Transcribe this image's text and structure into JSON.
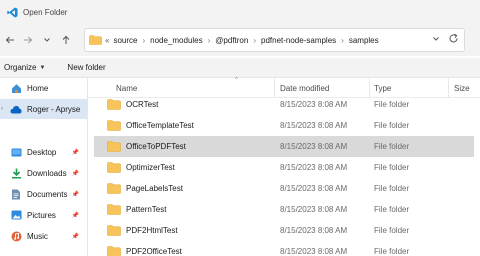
{
  "window": {
    "title": "Open Folder"
  },
  "nav": {
    "back_icon": "arrow-left-icon",
    "forward_icon": "arrow-right-icon",
    "recent_icon": "chevron-down-icon",
    "up_icon": "arrow-up-icon",
    "breadcrumbs": [
      "source",
      "node_modules",
      "@pdftron",
      "pdfnet-node-samples",
      "samples"
    ],
    "overflow": "«",
    "refresh_icon": "refresh-icon"
  },
  "toolbar": {
    "organize": "Organize",
    "new_folder": "New folder"
  },
  "sidebar": {
    "items": [
      {
        "label": "Home",
        "icon": "home-icon",
        "pinned": false
      },
      {
        "label": "Roger - Apryse",
        "icon": "cloud-icon",
        "pinned": false
      },
      {
        "label": "Desktop",
        "icon": "desktop-icon",
        "pinned": true
      },
      {
        "label": "Downloads",
        "icon": "download-icon",
        "pinned": true
      },
      {
        "label": "Documents",
        "icon": "documents-icon",
        "pinned": true
      },
      {
        "label": "Pictures",
        "icon": "pictures-icon",
        "pinned": true
      },
      {
        "label": "Music",
        "icon": "music-icon",
        "pinned": true
      }
    ]
  },
  "list": {
    "columns": {
      "name": "Name",
      "date": "Date modified",
      "type": "Type",
      "size": "Size"
    },
    "rows": [
      {
        "name": "OCRTest",
        "date": "8/15/2023 8:08 AM",
        "type": "File folder"
      },
      {
        "name": "OfficeTemplateTest",
        "date": "8/15/2023 8:08 AM",
        "type": "File folder"
      },
      {
        "name": "OfficeToPDFTest",
        "date": "8/15/2023 8:08 AM",
        "type": "File folder",
        "selected": true
      },
      {
        "name": "OptimizerTest",
        "date": "8/15/2023 8:08 AM",
        "type": "File folder"
      },
      {
        "name": "PageLabelsTest",
        "date": "8/15/2023 8:08 AM",
        "type": "File folder"
      },
      {
        "name": "PatternTest",
        "date": "8/15/2023 8:08 AM",
        "type": "File folder"
      },
      {
        "name": "PDF2HtmlTest",
        "date": "8/15/2023 8:08 AM",
        "type": "File folder"
      },
      {
        "name": "PDF2OfficeTest",
        "date": "8/15/2023 8:08 AM",
        "type": "File folder"
      }
    ]
  },
  "colors": {
    "folder": "#f6c45a",
    "folder_dark": "#e3a93b",
    "selected_row": "#d9d9d9",
    "selected_nav": "#dbe6f4",
    "accent_blue": "#0a64c8"
  }
}
